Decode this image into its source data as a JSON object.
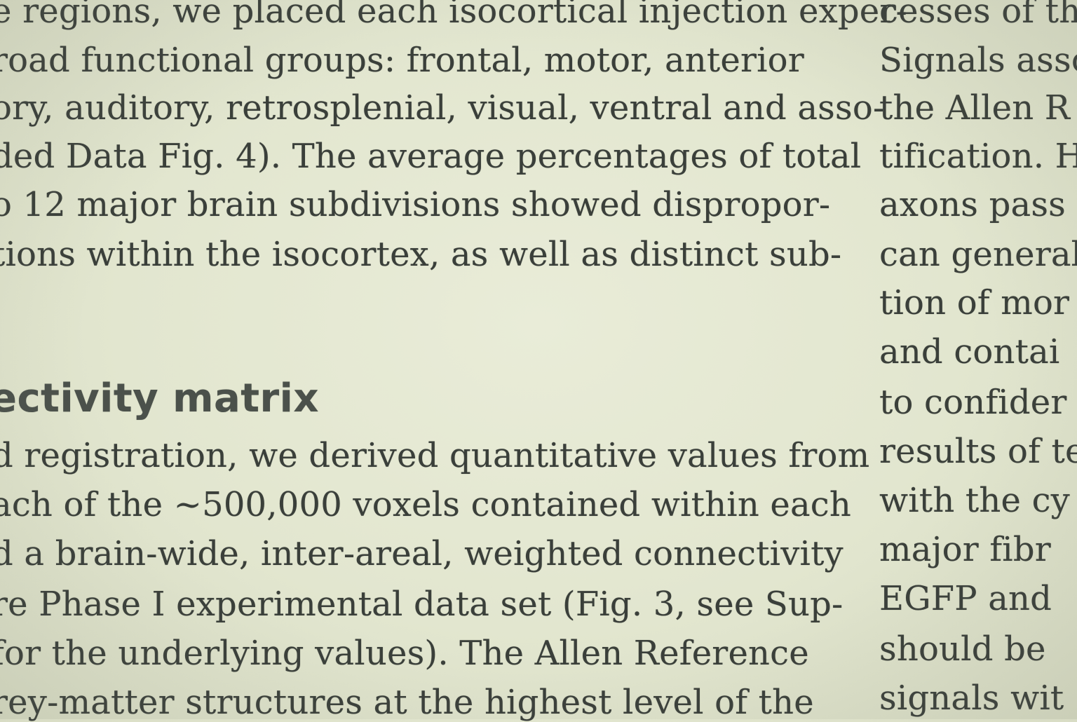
{
  "left_column": {
    "paragraph_1": [
      "e regions, we placed each isocortical injection exper-",
      "road functional groups: frontal, motor, anterior",
      "ory, auditory, retrosplenial, visual, ventral and asso-",
      "ded Data Fig. 4). The average percentages of total",
      "o 12 major brain subdivisions showed dispropor-",
      "tions within the isocortex, as well as distinct sub-"
    ],
    "section_heading": "ectivity matrix",
    "paragraph_2": [
      "d registration, we derived quantitative values from",
      "ach of the ~500,000 voxels contained within each",
      "d a brain-wide, inter-areal, weighted connectivity",
      "re Phase I experimental data set (Fig. 3, see Sup-",
      "for the underlying values). The Allen Reference",
      "rey-matter structures at the highest level of the"
    ]
  },
  "right_column": {
    "lines": [
      "cesses of the",
      "Signals asso",
      "the Allen R",
      "tification. H",
      "axons pass t",
      "can general",
      "tion of mor",
      "and contai",
      "to confider",
      "results of te",
      "with the cy",
      "major fibr",
      "EGFP and",
      "should be",
      "signals wit"
    ]
  }
}
